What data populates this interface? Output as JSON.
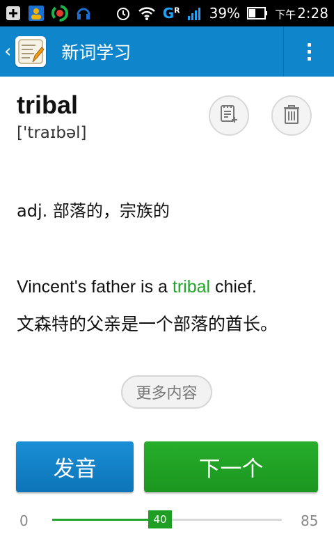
{
  "status_bar": {
    "network_label": "G",
    "roaming_label": "R",
    "battery": "39%",
    "time_prefix": "下午",
    "time": "2:28",
    "icons": [
      "plus-box-icon",
      "contact-card-icon",
      "app-swirl-icon",
      "headset-icon",
      "alarm-clock-icon",
      "wifi-icon",
      "signal-icon",
      "battery-icon"
    ]
  },
  "action_bar": {
    "title": "新词学习",
    "color": "#0f86cc"
  },
  "word": {
    "text": "tribal",
    "phonetic": "['traɪbəl]"
  },
  "definition": "adj. 部落的，宗族的",
  "example": {
    "en_before": "Vincent's father is a ",
    "en_highlight": "tribal",
    "en_after": " chief.",
    "zh": "文森特的父亲是一个部落的酋长。"
  },
  "more_button": "更多内容",
  "buttons": {
    "pronounce": "发音",
    "next": "下一个"
  },
  "progress": {
    "min": "0",
    "max": "85",
    "current": 40,
    "current_label": "40"
  },
  "colors": {
    "primary_blue": "#0f86cc",
    "accent_green": "#22a52a"
  }
}
